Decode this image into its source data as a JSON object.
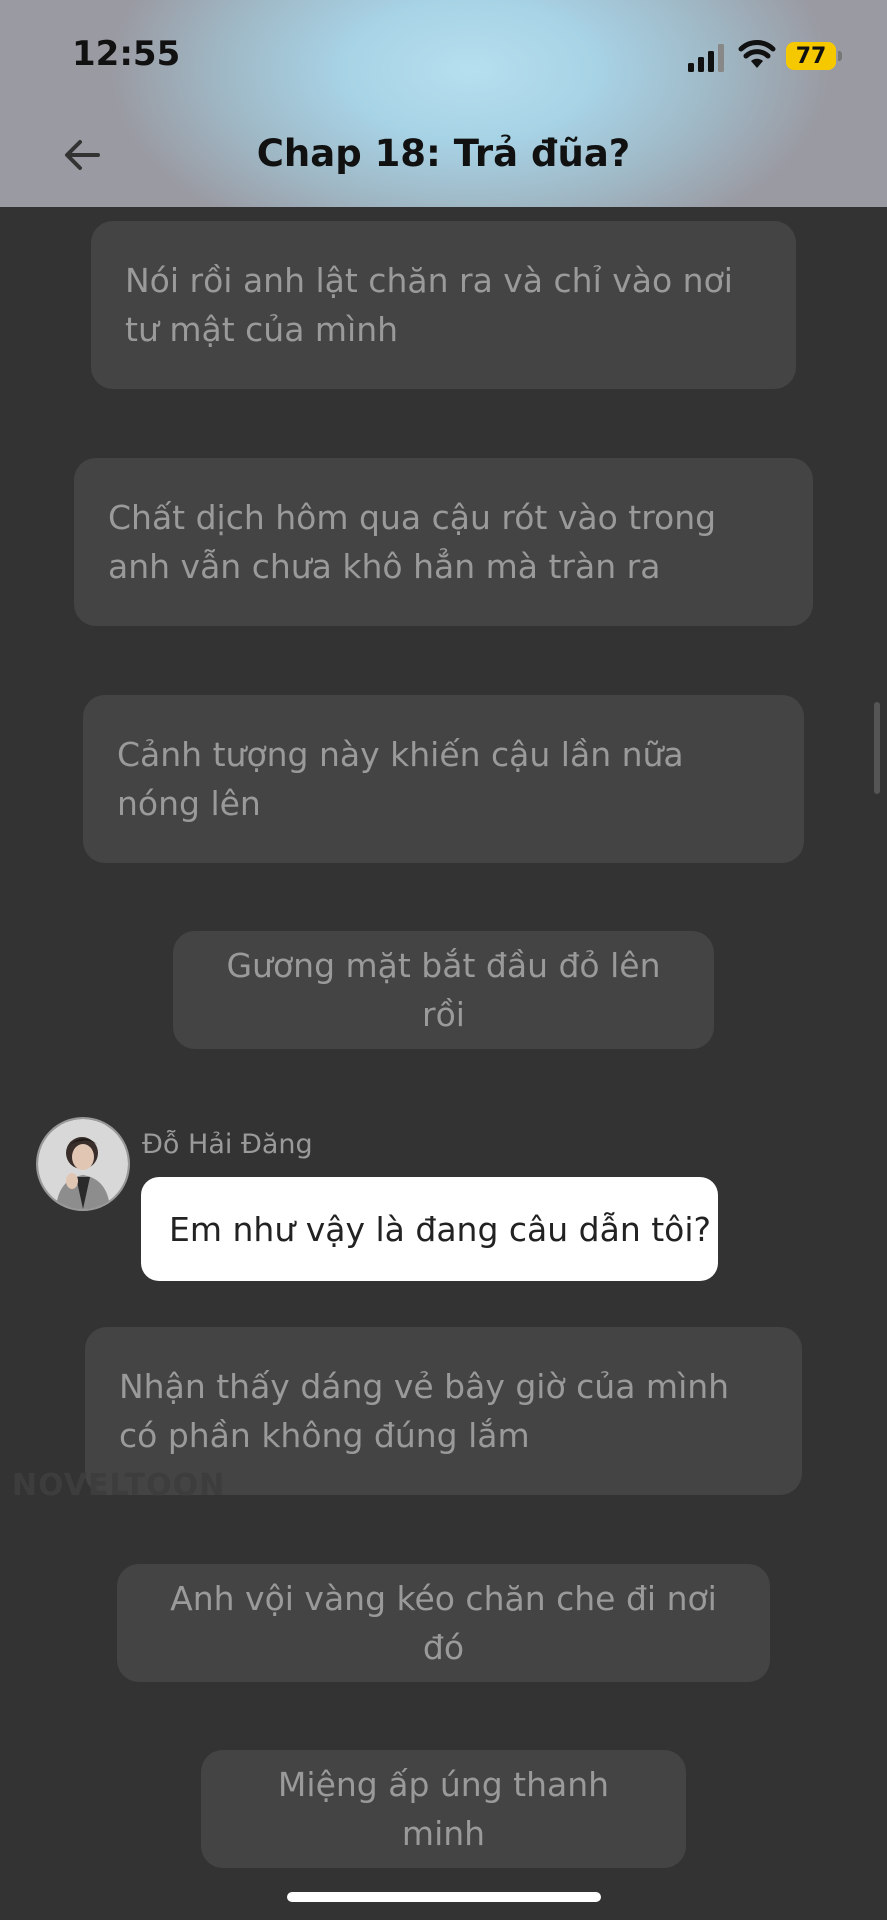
{
  "status_bar": {
    "time": "12:55",
    "battery": "77",
    "signal_icon": "signal-bars-icon",
    "wifi_icon": "wifi-icon"
  },
  "header": {
    "title": "Chap 18: Trả đũa?",
    "back_icon": "arrow-left-icon"
  },
  "narration": [
    "Nói rồi anh lật chăn ra và chỉ vào nơi tư mật của mình",
    "Chất dịch hôm qua cậu rót vào trong anh vẫn chưa khô hẳn mà tràn ra",
    "Cảnh tượng này khiến cậu lần nữa nóng lên",
    "Gương mặt bắt đầu đỏ lên rồi",
    "Nhận thấy dáng vẻ bây giờ của mình có phần không đúng lắm",
    "Anh vội vàng kéo chăn che đi nơi đó",
    "Miệng ấp úng thanh minh"
  ],
  "dialogue": {
    "speaker": "Đỗ Hải Đăng",
    "text": "Em như vậy là đang câu dẫn tôi?"
  },
  "watermark": "NOVELTOON",
  "colors": {
    "background": "#333333",
    "bubble": "#444444",
    "narration_text": "#9a9a9a",
    "battery": "#f5c800"
  }
}
